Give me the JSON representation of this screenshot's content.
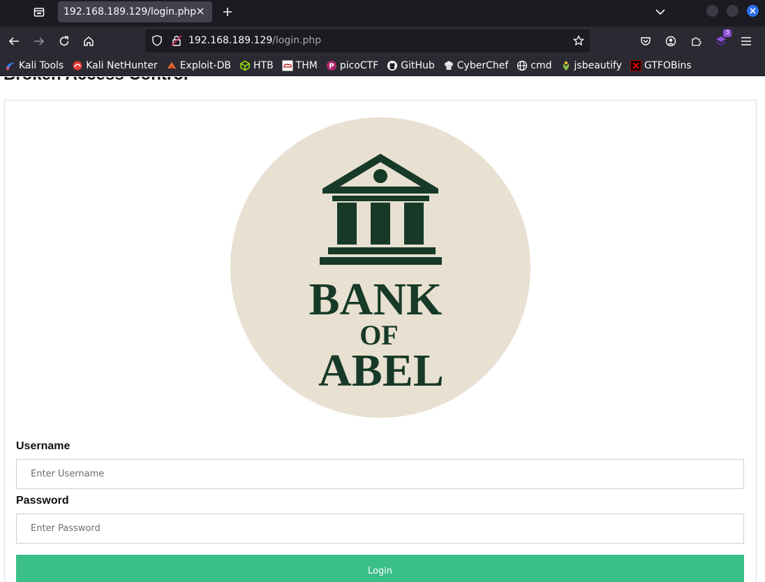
{
  "browser": {
    "tab": {
      "title": "192.168.189.129/login.php"
    },
    "url": {
      "host": "192.168.189.129",
      "path": "/login.php"
    },
    "extension_badge": "3",
    "bookmarks": [
      {
        "label": "Kali Tools",
        "icon": "kali-icon",
        "color": "#367bf0"
      },
      {
        "label": "Kali NetHunter",
        "icon": "nethunter-icon",
        "color": "#e53935"
      },
      {
        "label": "Exploit-DB",
        "icon": "exploitdb-icon",
        "color": "#f0702f"
      },
      {
        "label": "HTB",
        "icon": "htb-cube-icon",
        "color": "#9fef00"
      },
      {
        "label": "THM",
        "icon": "thm-icon",
        "color": "#c11111"
      },
      {
        "label": "picoCTF",
        "icon": "picoctf-icon",
        "color": "#b0266b"
      },
      {
        "label": "GitHub",
        "icon": "github-icon",
        "color": "#ffffff"
      },
      {
        "label": "CyberChef",
        "icon": "cyberchef-icon",
        "color": "#dddddd"
      },
      {
        "label": "cmd",
        "icon": "globe-icon",
        "color": "#fbfbfe"
      },
      {
        "label": "jsbeautify",
        "icon": "jsbeautify-icon",
        "color": "#8bc34a"
      },
      {
        "label": "GTFOBins",
        "icon": "gtfobins-icon",
        "color": "#b00000"
      }
    ]
  },
  "page": {
    "heading": "Broken Access Control",
    "logo": {
      "line1": "BANK",
      "line2": "OF",
      "line3": "ABEL",
      "bg_color": "#e8e0d1",
      "fg_color": "#163a27"
    },
    "form": {
      "username_label": "Username",
      "username_placeholder": "Enter Username",
      "password_label": "Password",
      "password_placeholder": "Enter Password",
      "login_label": "Login",
      "button_color": "#3abf88"
    }
  }
}
